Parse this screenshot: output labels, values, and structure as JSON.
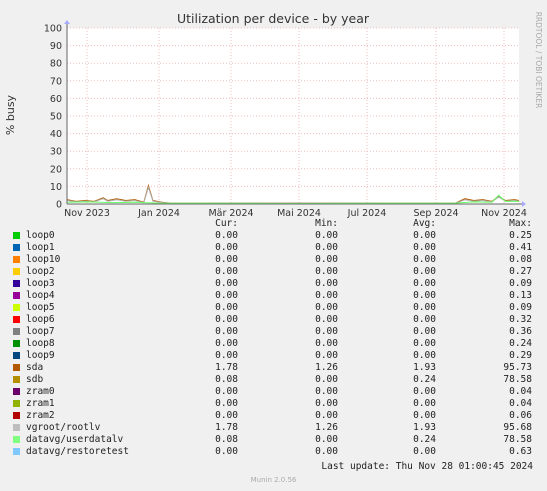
{
  "side_label": "RRDTOOL / TOBI OETIKER",
  "chart_data": {
    "type": "line",
    "title": "Utilization per device - by year",
    "ylabel": "% busy",
    "ylim": [
      0,
      100
    ],
    "yticks": [
      0,
      10,
      20,
      30,
      40,
      50,
      60,
      70,
      80,
      90,
      100
    ],
    "xticks": [
      "Nov 2023",
      "Jan 2024",
      "Mär 2024",
      "Mai 2024",
      "Jul 2024",
      "Sep 2024",
      "Nov 2024"
    ],
    "grid": true,
    "series": [
      {
        "name": "sda",
        "color": "#b35a00",
        "points": [
          [
            0,
            2.5
          ],
          [
            0.02,
            1.5
          ],
          [
            0.04,
            2.0
          ],
          [
            0.06,
            1.5
          ],
          [
            0.08,
            3.5
          ],
          [
            0.09,
            2.0
          ],
          [
            0.11,
            3.0
          ],
          [
            0.13,
            2.0
          ],
          [
            0.15,
            2.5
          ],
          [
            0.17,
            1.0
          ],
          [
            0.18,
            10.5
          ],
          [
            0.19,
            2.0
          ],
          [
            0.21,
            1.0
          ],
          [
            0.23,
            0.5
          ],
          [
            0.25,
            0.5
          ],
          [
            0.5,
            0.5
          ],
          [
            0.86,
            0.5
          ],
          [
            0.88,
            3.0
          ],
          [
            0.9,
            2.0
          ],
          [
            0.92,
            2.5
          ],
          [
            0.94,
            1.5
          ],
          [
            0.955,
            4.5
          ],
          [
            0.97,
            2.0
          ],
          [
            0.99,
            2.5
          ],
          [
            1,
            2.0
          ]
        ]
      },
      {
        "name": "vgroot/rootlv",
        "color": "#b0b0b0",
        "points": [
          [
            0,
            2.0
          ],
          [
            0.02,
            1.2
          ],
          [
            0.04,
            1.6
          ],
          [
            0.06,
            1.2
          ],
          [
            0.08,
            3.0
          ],
          [
            0.09,
            1.6
          ],
          [
            0.11,
            2.4
          ],
          [
            0.13,
            1.6
          ],
          [
            0.15,
            2.0
          ],
          [
            0.17,
            0.8
          ],
          [
            0.18,
            9.5
          ],
          [
            0.19,
            1.6
          ],
          [
            0.21,
            0.8
          ],
          [
            0.23,
            0.4
          ],
          [
            0.5,
            0.4
          ],
          [
            0.86,
            0.4
          ],
          [
            0.88,
            2.4
          ],
          [
            0.9,
            1.6
          ],
          [
            0.92,
            2.0
          ],
          [
            0.94,
            1.2
          ],
          [
            0.955,
            4.0
          ],
          [
            0.97,
            1.6
          ],
          [
            0.99,
            2.0
          ],
          [
            1,
            1.6
          ]
        ]
      },
      {
        "name": "datavg/userdatalv",
        "color": "#66ff66",
        "points": [
          [
            0,
            1.0
          ],
          [
            0.05,
            1.2
          ],
          [
            0.1,
            0.8
          ],
          [
            0.15,
            1.0
          ],
          [
            0.2,
            0.5
          ],
          [
            0.5,
            0.3
          ],
          [
            0.86,
            0.5
          ],
          [
            0.9,
            1.2
          ],
          [
            0.94,
            1.0
          ],
          [
            0.955,
            5.0
          ],
          [
            0.97,
            1.5
          ],
          [
            1,
            1.5
          ]
        ]
      }
    ]
  },
  "legend": {
    "headers": {
      "cur": "Cur:",
      "min": "Min:",
      "avg": "Avg:",
      "max": "Max:"
    },
    "rows": [
      {
        "name": "loop0",
        "color": "#00cc00",
        "cur": "0.00",
        "min": "0.00",
        "avg": "0.00",
        "max": "0.25"
      },
      {
        "name": "loop1",
        "color": "#0066b3",
        "cur": "0.00",
        "min": "0.00",
        "avg": "0.00",
        "max": "0.41"
      },
      {
        "name": "loop10",
        "color": "#ff8000",
        "cur": "0.00",
        "min": "0.00",
        "avg": "0.00",
        "max": "0.08"
      },
      {
        "name": "loop2",
        "color": "#ffcc00",
        "cur": "0.00",
        "min": "0.00",
        "avg": "0.00",
        "max": "0.27"
      },
      {
        "name": "loop3",
        "color": "#330099",
        "cur": "0.00",
        "min": "0.00",
        "avg": "0.00",
        "max": "0.09"
      },
      {
        "name": "loop4",
        "color": "#990099",
        "cur": "0.00",
        "min": "0.00",
        "avg": "0.00",
        "max": "0.13"
      },
      {
        "name": "loop5",
        "color": "#ccff00",
        "cur": "0.00",
        "min": "0.00",
        "avg": "0.00",
        "max": "0.09"
      },
      {
        "name": "loop6",
        "color": "#ff0000",
        "cur": "0.00",
        "min": "0.00",
        "avg": "0.00",
        "max": "0.32"
      },
      {
        "name": "loop7",
        "color": "#808080",
        "cur": "0.00",
        "min": "0.00",
        "avg": "0.00",
        "max": "0.36"
      },
      {
        "name": "loop8",
        "color": "#008f00",
        "cur": "0.00",
        "min": "0.00",
        "avg": "0.00",
        "max": "0.24"
      },
      {
        "name": "loop9",
        "color": "#00487d",
        "cur": "0.00",
        "min": "0.00",
        "avg": "0.00",
        "max": "0.29"
      },
      {
        "name": "sda",
        "color": "#b35a00",
        "cur": "1.78",
        "min": "1.26",
        "avg": "1.93",
        "max": "95.73"
      },
      {
        "name": "sdb",
        "color": "#b38f00",
        "cur": "0.08",
        "min": "0.00",
        "avg": "0.24",
        "max": "78.58"
      },
      {
        "name": "zram0",
        "color": "#6b006b",
        "cur": "0.00",
        "min": "0.00",
        "avg": "0.00",
        "max": "0.04"
      },
      {
        "name": "zram1",
        "color": "#8fb300",
        "cur": "0.00",
        "min": "0.00",
        "avg": "0.00",
        "max": "0.04"
      },
      {
        "name": "zram2",
        "color": "#b30000",
        "cur": "0.00",
        "min": "0.00",
        "avg": "0.00",
        "max": "0.06"
      },
      {
        "name": "vgroot/rootlv",
        "color": "#bebebe",
        "cur": "1.78",
        "min": "1.26",
        "avg": "1.93",
        "max": "95.68"
      },
      {
        "name": "datavg/userdatalv",
        "color": "#80ff80",
        "cur": "0.08",
        "min": "0.00",
        "avg": "0.24",
        "max": "78.58"
      },
      {
        "name": "datavg/restoretest",
        "color": "#80c9ff",
        "cur": "0.00",
        "min": "0.00",
        "avg": "0.00",
        "max": "0.63"
      }
    ]
  },
  "last_update": "Last update: Thu Nov 28 01:00:45 2024",
  "version": "Munin 2.0.56"
}
